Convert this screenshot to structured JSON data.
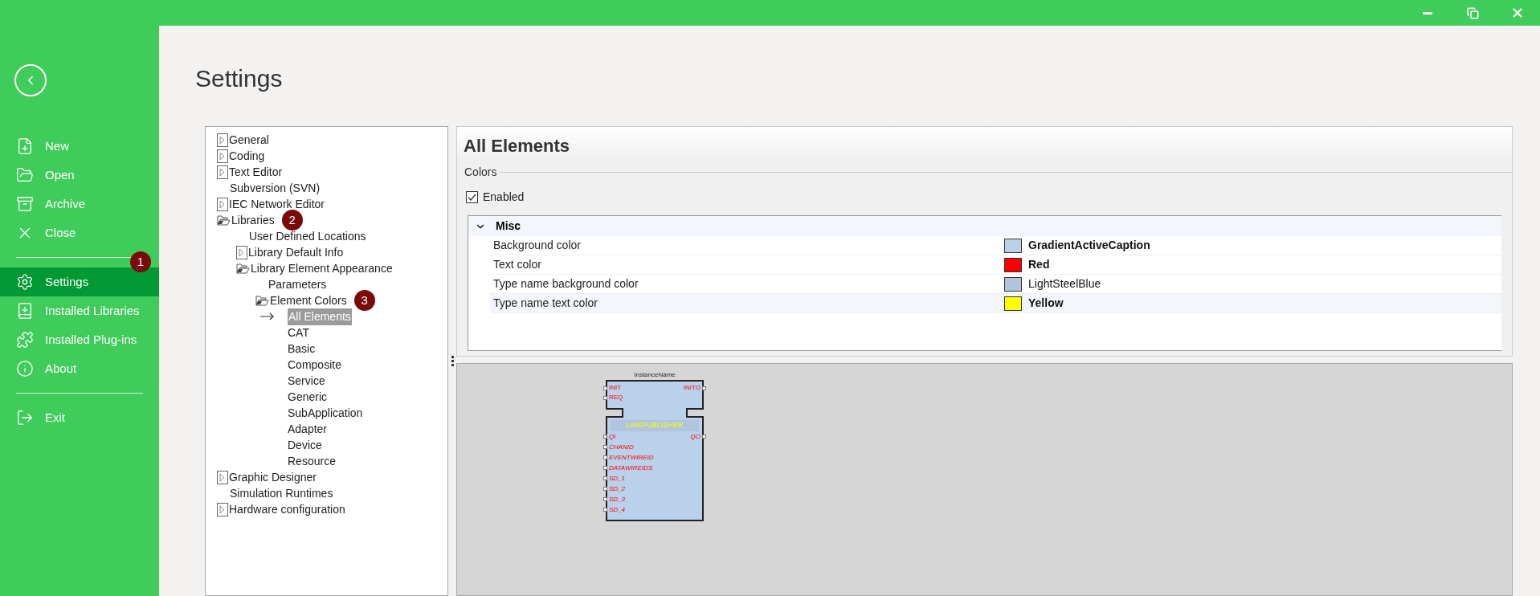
{
  "sidebar": {
    "groups": [
      [
        {
          "label": "New",
          "selected": false
        },
        {
          "label": "Open",
          "selected": false
        },
        {
          "label": "Archive",
          "selected": false
        },
        {
          "label": "Close",
          "selected": false
        }
      ],
      [
        {
          "label": "Settings",
          "selected": true,
          "badge": "1"
        },
        {
          "label": "Installed Libraries",
          "selected": false
        },
        {
          "label": "Installed Plug-ins",
          "selected": false
        },
        {
          "label": "About",
          "selected": false
        }
      ],
      [
        {
          "label": "Exit",
          "selected": false
        }
      ]
    ]
  },
  "page_title": "Settings",
  "tree": [
    {
      "label": "General",
      "expanded": false,
      "selected": false
    },
    {
      "label": "Coding",
      "expanded": false,
      "selected": false
    },
    {
      "label": "Text Editor",
      "expanded": false,
      "selected": false
    },
    {
      "label": "Subversion (SVN)",
      "selected": false
    },
    {
      "label": "IEC Network Editor",
      "expanded": false,
      "selected": false
    },
    {
      "label": "Libraries",
      "expanded": true,
      "selected": false,
      "badge": "2",
      "children": [
        {
          "label": "User Defined Locations",
          "selected": false
        },
        {
          "label": "Library Default Info",
          "expanded": false,
          "selected": false
        },
        {
          "label": "Library Element Appearance",
          "expanded": true,
          "selected": false,
          "children": [
            {
              "label": "Parameters",
              "selected": false
            },
            {
              "label": "Element Colors",
              "expanded": true,
              "selected": false,
              "badge": "3",
              "children": [
                {
                  "label": "All Elements",
                  "selected": true
                },
                {
                  "label": "CAT",
                  "selected": false
                },
                {
                  "label": "Basic",
                  "selected": false
                },
                {
                  "label": "Composite",
                  "selected": false
                },
                {
                  "label": "Service",
                  "selected": false
                },
                {
                  "label": "Generic",
                  "selected": false
                },
                {
                  "label": "SubApplication",
                  "selected": false
                },
                {
                  "label": "Adapter",
                  "selected": false
                },
                {
                  "label": "Device",
                  "selected": false
                },
                {
                  "label": "Resource",
                  "selected": false
                }
              ]
            }
          ]
        }
      ]
    },
    {
      "label": "Graphic Designer",
      "expanded": false,
      "selected": false
    },
    {
      "label": "Simulation Runtimes",
      "selected": false
    },
    {
      "label": "Hardware configuration",
      "expanded": false,
      "selected": false
    }
  ],
  "panel": {
    "title": "All Elements",
    "group_label": "Colors",
    "enabled": {
      "label": "Enabled",
      "checked": true
    },
    "category": {
      "label": "Misc",
      "expanded": true,
      "rows": [
        {
          "name": "Background color",
          "color": "#b9d1ea",
          "value": "GradientActiveCaption",
          "modified": true,
          "selected": false
        },
        {
          "name": "Text color",
          "color": "#ff0000",
          "value": "Red",
          "modified": true,
          "selected": false
        },
        {
          "name": "Type name background color",
          "color": "#b0c4de",
          "value": "LightSteelBlue",
          "modified": false,
          "selected": false
        },
        {
          "name": "Type name text color",
          "color": "#ffff00",
          "value": "Yellow",
          "modified": true,
          "selected": true
        }
      ]
    }
  },
  "preview": {
    "instance_name": "InstanceName",
    "type_name": "LINKPUBLISHER",
    "event_inputs": [
      "INIT",
      "REQ"
    ],
    "event_outputs": [
      "INITO"
    ],
    "data_inputs": [
      "QI",
      "CHANID",
      "EVENTWIREID",
      "DATAWIREIDS",
      "SD_1",
      "SD_2",
      "SD_3",
      "SD_4"
    ],
    "data_outputs": [
      "QO"
    ]
  }
}
